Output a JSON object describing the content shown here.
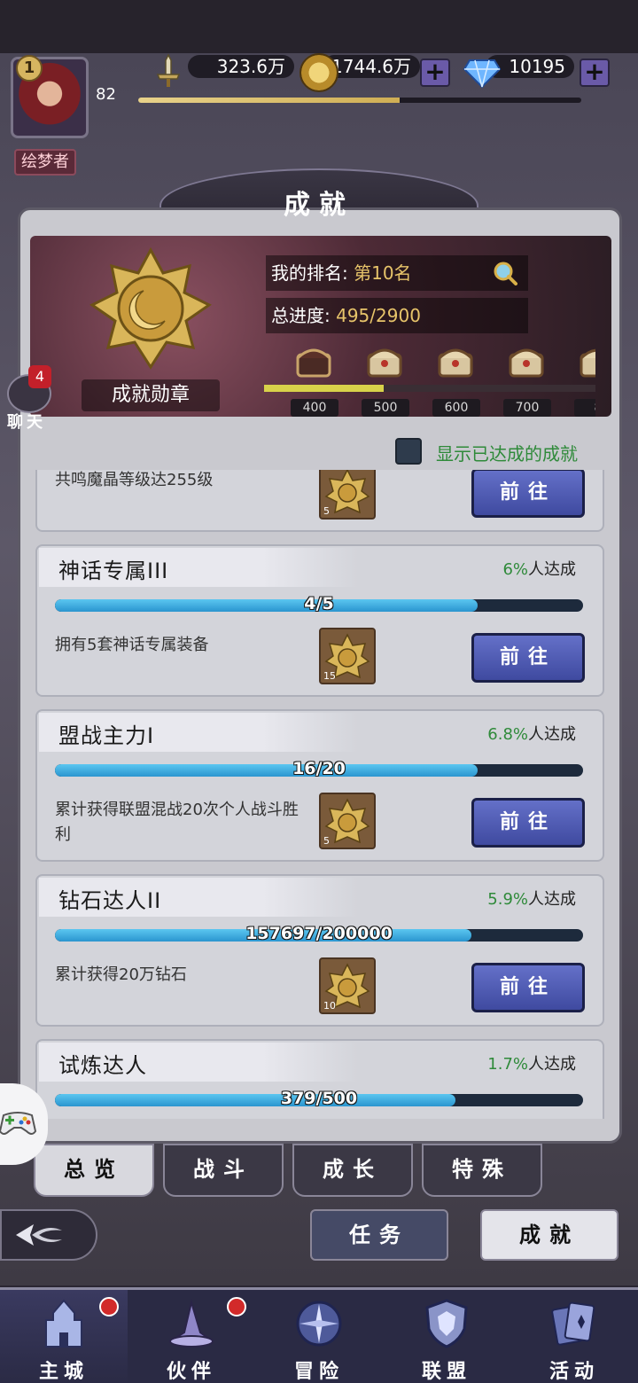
{
  "hud": {
    "level_badge": "1",
    "player_level": "82",
    "exp_fraction": 0.59,
    "power": "323.6万",
    "gold": "1744.6万",
    "diamonds": "10195",
    "plus_symbol": "+",
    "title_tag": "绘梦者"
  },
  "page": {
    "title": "成就"
  },
  "banner": {
    "medal_label": "成就勋章",
    "rank_label": "我的排名:",
    "rank_value": "第10名",
    "progress_label": "总进度:",
    "progress_value": "495/2900",
    "milestone_fill": 0.36,
    "milestones": [
      "400",
      "500",
      "600",
      "700",
      "8"
    ]
  },
  "chat": {
    "label": "聊天",
    "badge": "4"
  },
  "filter": {
    "label": "显示已达成的成就"
  },
  "achievements": [
    {
      "title": "",
      "rate_num": "",
      "rate_suffix": "",
      "progress_text": "",
      "progress": 0,
      "desc": "共鸣魔晶等级达255级",
      "reward_count": "5",
      "button": "前往"
    },
    {
      "title": "神话专属III",
      "rate_num": "6%",
      "rate_suffix": "人达成",
      "progress_text": "4/5",
      "progress": 0.8,
      "desc": "拥有5套神话专属装备",
      "reward_count": "15",
      "button": "前往"
    },
    {
      "title": "盟战主力I",
      "rate_num": "6.8%",
      "rate_suffix": "人达成",
      "progress_text": "16/20",
      "progress": 0.8,
      "desc": "累计获得联盟混战20次个人战斗胜利",
      "reward_count": "5",
      "button": "前往"
    },
    {
      "title": "钻石达人II",
      "rate_num": "5.9%",
      "rate_suffix": "人达成",
      "progress_text": "157697/200000",
      "progress": 0.788,
      "desc": "累计获得20万钻石",
      "reward_count": "10",
      "button": "前往"
    },
    {
      "title": "试炼达人",
      "rate_num": "1.7%",
      "rate_suffix": "人达成",
      "progress_text": "379/500",
      "progress": 0.758,
      "desc": "",
      "reward_count": "",
      "button": ""
    }
  ],
  "category_tabs": [
    "总览",
    "战斗",
    "成长",
    "特殊"
  ],
  "mode_buttons": {
    "task": "任务",
    "achievement": "成就"
  },
  "bottom_nav": [
    "主城",
    "伙伴",
    "冒险",
    "联盟",
    "活动"
  ],
  "colors": {
    "accent_green": "#2f8a3a",
    "progress_blue": "#2a95cf",
    "button_blue": "#3f4aa0",
    "gold": "#e7c46a"
  }
}
